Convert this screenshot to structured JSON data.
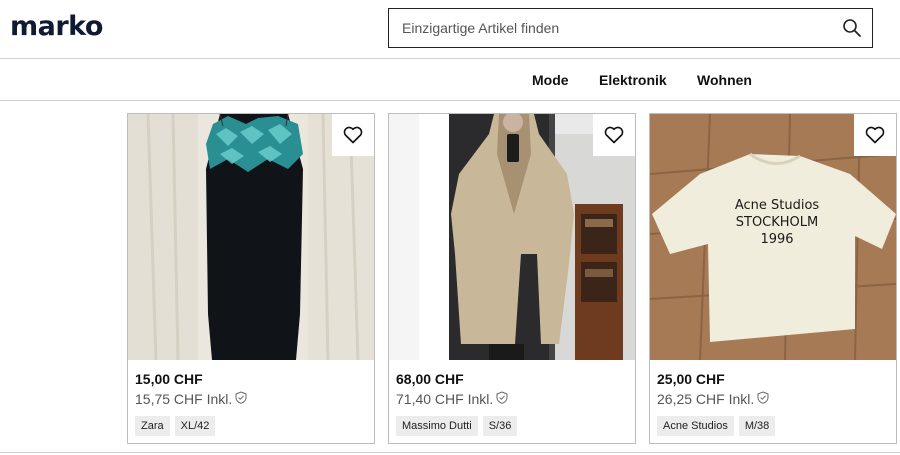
{
  "brand": {
    "logo_text": "marko",
    "logo_color": "#0f1b33"
  },
  "search": {
    "placeholder": "Einzigartige Artikel finden",
    "icon": "search-icon"
  },
  "nav": {
    "items": [
      {
        "label": "Mode"
      },
      {
        "label": "Elektronik"
      },
      {
        "label": "Wohnen"
      }
    ]
  },
  "listings": [
    {
      "price": "15,00 CHF",
      "price_incl": "15,75 CHF Inkl.",
      "brand": "Zara",
      "size": "XL/42",
      "image": "black velvet slip dress with turquoise lace top"
    },
    {
      "price": "68,00 CHF",
      "price_incl": "71,40 CHF Inkl.",
      "brand": "Massimo Dutti",
      "size": "S/36",
      "image": "beige trench coat mirror selfie"
    },
    {
      "price": "25,00 CHF",
      "price_incl": "26,25 CHF Inkl.",
      "brand": "Acne Studios",
      "size": "M/38",
      "image": "cream t-shirt with Acne Studios Stockholm 1996 print",
      "print_text": [
        "Acne Studios",
        "STOCKHOLM",
        "1996"
      ]
    }
  ],
  "icons": {
    "favorite": "heart-icon",
    "protection": "shield-check-icon"
  }
}
